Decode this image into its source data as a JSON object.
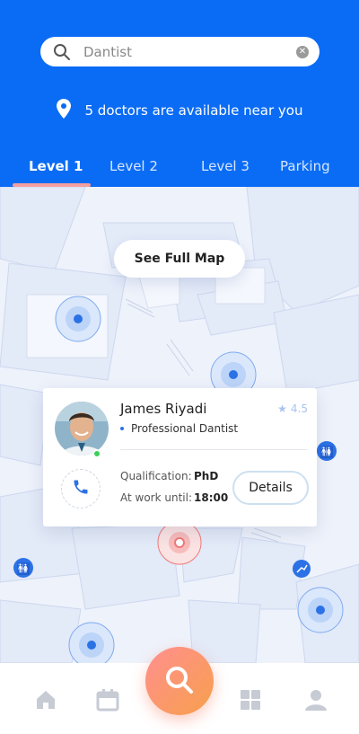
{
  "search": {
    "placeholder": "Dantist",
    "value": ""
  },
  "availability": {
    "text": "5 doctors are available near you"
  },
  "tabs": [
    {
      "label": "Level 1",
      "active": true
    },
    {
      "label": "Level 2",
      "active": false
    },
    {
      "label": "Level 3",
      "active": false
    },
    {
      "label": "Parking",
      "active": false
    }
  ],
  "map": {
    "see_full_map_label": "See Full Map"
  },
  "doctor": {
    "name": "James Riyadi",
    "rating": "4.5",
    "profession": "Professional Dantist",
    "qualification_label": "Qualification:",
    "qualification": "PhD",
    "work_label": "At work until:",
    "work_until": "18:00",
    "details_label": "Details",
    "online": true
  },
  "nav": {
    "items": [
      "home-icon",
      "calendar-icon",
      "search-icon",
      "grid-icon",
      "profile-icon"
    ],
    "active": "search-icon"
  },
  "colors": {
    "header": "#0a6cf5",
    "accent_start": "#ff8f8f",
    "accent_end": "#f7a04c",
    "map_marker": "#2c72e6",
    "tab_underline": "#f3a0a0"
  }
}
